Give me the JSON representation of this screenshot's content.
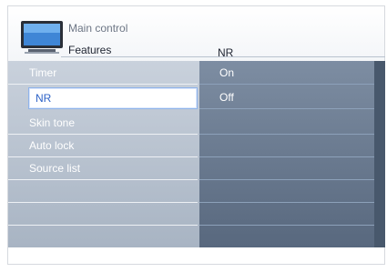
{
  "header": {
    "breadcrumb": "Main control",
    "section_title": "Features",
    "column_header": "NR"
  },
  "menu": {
    "items": [
      {
        "label": "Timer",
        "selected": false
      },
      {
        "label": "NR",
        "selected": true
      },
      {
        "label": "Skin tone",
        "selected": false
      },
      {
        "label": "Auto lock",
        "selected": false
      },
      {
        "label": "Source list",
        "selected": false
      },
      {
        "label": "",
        "selected": false
      },
      {
        "label": "",
        "selected": false
      },
      {
        "label": "",
        "selected": false
      }
    ]
  },
  "options": {
    "items": [
      {
        "label": "On"
      },
      {
        "label": "Off"
      },
      {
        "label": ""
      },
      {
        "label": ""
      },
      {
        "label": ""
      },
      {
        "label": ""
      },
      {
        "label": ""
      },
      {
        "label": ""
      }
    ]
  },
  "colors": {
    "selection_text": "#2e63c7",
    "left_panel": "#b7c1ce",
    "right_panel": "#6a7b91"
  }
}
